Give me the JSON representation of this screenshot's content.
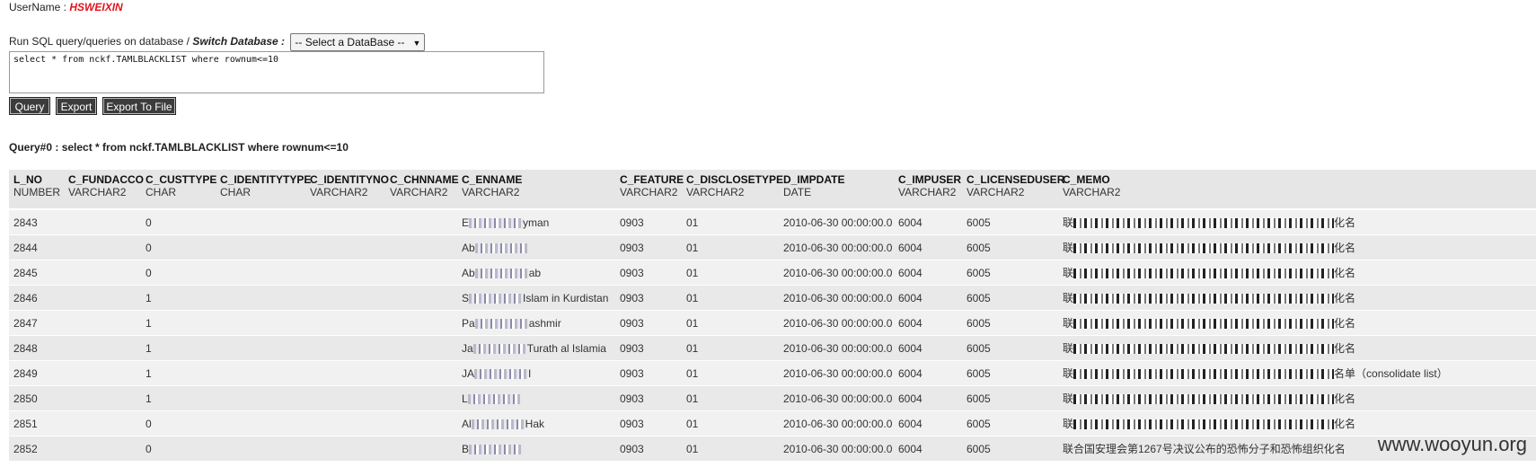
{
  "user": {
    "label": "UserName : ",
    "name": "HSWEIXIN"
  },
  "sql": {
    "prefix": "Run SQL query/queries on database / ",
    "switch_label": "Switch Database :",
    "db_select": "-- Select a DataBase --",
    "query_text": "select * from nckf.TAMLBLACKLIST where rownum<=10"
  },
  "buttons": {
    "query": "Query",
    "export": "Export",
    "export_to_file": "Export To File"
  },
  "query_caption": "Query#0 : select * from nckf.TAMLBLACKLIST where rownum<=10",
  "table": {
    "columns": [
      {
        "name": "L_NO",
        "type": "NUMBER"
      },
      {
        "name": "C_FUNDACCO",
        "type": "VARCHAR2"
      },
      {
        "name": "C_CUSTTYPE",
        "type": "CHAR"
      },
      {
        "name": "C_IDENTITYTYPE",
        "type": "CHAR"
      },
      {
        "name": "C_IDENTITYNO",
        "type": "VARCHAR2"
      },
      {
        "name": "C_CHNNAME",
        "type": "VARCHAR2"
      },
      {
        "name": "C_ENNAME",
        "type": "VARCHAR2"
      },
      {
        "name": "C_FEATURE",
        "type": "VARCHAR2"
      },
      {
        "name": "C_DISCLOSETYPE",
        "type": "VARCHAR2"
      },
      {
        "name": "D_IMPDATE",
        "type": "DATE"
      },
      {
        "name": "C_IMPUSER",
        "type": "VARCHAR2"
      },
      {
        "name": "C_LICENSEDUSER",
        "type": "VARCHAR2"
      },
      {
        "name": "C_MEMO",
        "type": "VARCHAR2"
      }
    ],
    "rows": [
      {
        "no": "2843",
        "fundacco": "",
        "custtype": "0",
        "idtype": "",
        "idno": "",
        "chnname": "",
        "en_a": "E",
        "en_b": "yman",
        "feature": "0903",
        "disclose": "01",
        "impdate": "2010-06-30 00:00:00.0",
        "impuser": "6004",
        "licuser": "6005",
        "memo_a": "联",
        "memo_b": "化名"
      },
      {
        "no": "2844",
        "fundacco": "",
        "custtype": "0",
        "idtype": "",
        "idno": "",
        "chnname": "",
        "en_a": "Ab",
        "en_b": "",
        "feature": "0903",
        "disclose": "01",
        "impdate": "2010-06-30 00:00:00.0",
        "impuser": "6004",
        "licuser": "6005",
        "memo_a": "联",
        "memo_b": "化名"
      },
      {
        "no": "2845",
        "fundacco": "",
        "custtype": "0",
        "idtype": "",
        "idno": "",
        "chnname": "",
        "en_a": "Ab",
        "en_b": "ab",
        "feature": "0903",
        "disclose": "01",
        "impdate": "2010-06-30 00:00:00.0",
        "impuser": "6004",
        "licuser": "6005",
        "memo_a": "联",
        "memo_b": "化名"
      },
      {
        "no": "2846",
        "fundacco": "",
        "custtype": "1",
        "idtype": "",
        "idno": "",
        "chnname": "",
        "en_a": "S",
        "en_b": "Islam in Kurdistan",
        "feature": "0903",
        "disclose": "01",
        "impdate": "2010-06-30 00:00:00.0",
        "impuser": "6004",
        "licuser": "6005",
        "memo_a": "联",
        "memo_b": "化名"
      },
      {
        "no": "2847",
        "fundacco": "",
        "custtype": "1",
        "idtype": "",
        "idno": "",
        "chnname": "",
        "en_a": "Pa",
        "en_b": "ashmir",
        "feature": "0903",
        "disclose": "01",
        "impdate": "2010-06-30 00:00:00.0",
        "impuser": "6004",
        "licuser": "6005",
        "memo_a": "联",
        "memo_b": "化名"
      },
      {
        "no": "2848",
        "fundacco": "",
        "custtype": "1",
        "idtype": "",
        "idno": "",
        "chnname": "",
        "en_a": "Ja",
        "en_b": "Turath al Islamia",
        "feature": "0903",
        "disclose": "01",
        "impdate": "2010-06-30 00:00:00.0",
        "impuser": "6004",
        "licuser": "6005",
        "memo_a": "联",
        "memo_b": "化名"
      },
      {
        "no": "2849",
        "fundacco": "",
        "custtype": "1",
        "idtype": "",
        "idno": "",
        "chnname": "",
        "en_a": "JA",
        "en_b": "I",
        "feature": "0903",
        "disclose": "01",
        "impdate": "2010-06-30 00:00:00.0",
        "impuser": "6004",
        "licuser": "6005",
        "memo_a": "联",
        "memo_b": "名单（consolidate list）"
      },
      {
        "no": "2850",
        "fundacco": "",
        "custtype": "1",
        "idtype": "",
        "idno": "",
        "chnname": "",
        "en_a": "L",
        "en_b": "",
        "feature": "0903",
        "disclose": "01",
        "impdate": "2010-06-30 00:00:00.0",
        "impuser": "6004",
        "licuser": "6005",
        "memo_a": "联",
        "memo_b": "化名"
      },
      {
        "no": "2851",
        "fundacco": "",
        "custtype": "0",
        "idtype": "",
        "idno": "",
        "chnname": "",
        "en_a": "Al",
        "en_b": "Hak",
        "feature": "0903",
        "disclose": "01",
        "impdate": "2010-06-30 00:00:00.0",
        "impuser": "6004",
        "licuser": "6005",
        "memo_a": "联",
        "memo_b": "化名"
      },
      {
        "no": "2852",
        "fundacco": "",
        "custtype": "0",
        "idtype": "",
        "idno": "",
        "chnname": "",
        "en_a": "B",
        "en_b": "",
        "feature": "0903",
        "disclose": "01",
        "impdate": "2010-06-30 00:00:00.0",
        "impuser": "6004",
        "licuser": "6005",
        "memo_a": "联合国安理会第1267号决议公布的恐怖分子和恐怖组织化名",
        "memo_b": ""
      }
    ]
  },
  "watermark": "www.wooyun.org"
}
